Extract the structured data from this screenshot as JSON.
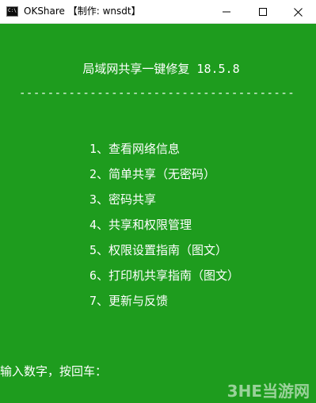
{
  "window": {
    "title": "OKShare 【制作: wnsdt】",
    "icon": "console-icon",
    "controls": {
      "minimize_icon": "minimize-icon",
      "maximize_icon": "maximize-icon",
      "close_icon": "close-icon"
    }
  },
  "console": {
    "background_color": "#1e9c1e",
    "text_color": "#ffffff",
    "title": "局域网共享一键修复 18.5.8",
    "separator": "----------------------------------------------",
    "menu": [
      {
        "label": "1、查看网络信息"
      },
      {
        "label": "2、简单共享（无密码）"
      },
      {
        "label": "3、密码共享"
      },
      {
        "label": "4、共享和权限管理"
      },
      {
        "label": "5、权限设置指南（图文）"
      },
      {
        "label": "6、打印机共享指南（图文）"
      },
      {
        "label": "7、更新与反馈"
      }
    ],
    "prompt": "输入数字，按回车："
  },
  "watermark": {
    "text": "3HE当游网"
  }
}
